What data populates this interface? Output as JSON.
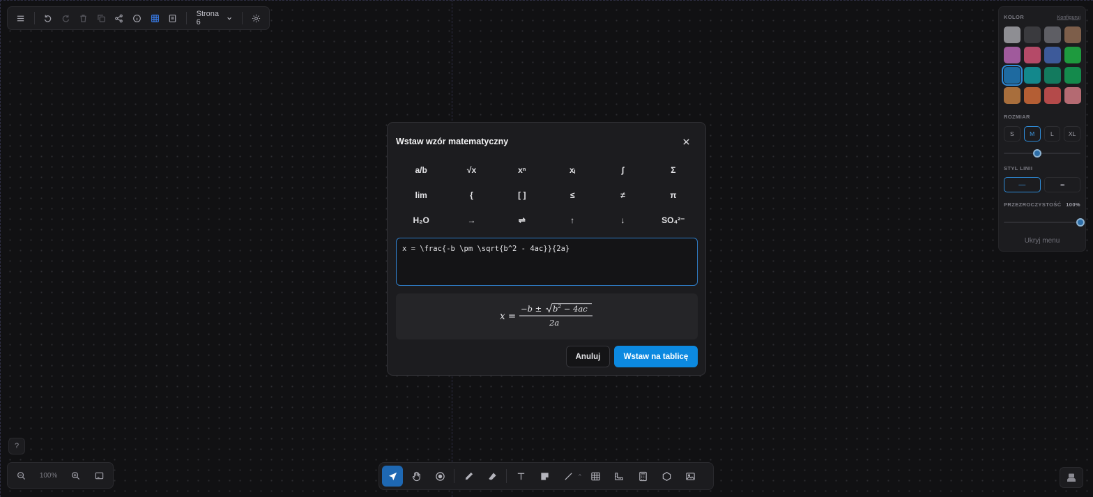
{
  "top_toolbar": {
    "page_label": "Strona 6"
  },
  "side_panel": {
    "color_label": "KOLOR",
    "configure_link": "Konfiguruj",
    "colors": [
      "#8e8e93",
      "#3a3a3e",
      "#5e5e64",
      "#7d5e4a",
      "#a05a9c",
      "#b54a68",
      "#3d5a9a",
      "#1e9a3e",
      "#1e6aa0",
      "#13888c",
      "#137a5e",
      "#148a4c",
      "#a86e3c",
      "#b45e34",
      "#b44a4a",
      "#b46a72"
    ],
    "selected_color_index": 8,
    "size_label": "ROZMIAR",
    "sizes": [
      "S",
      "M",
      "L",
      "XL"
    ],
    "selected_size": "M",
    "size_slider_fraction": 0.44,
    "line_style_label": "STYL LINII",
    "line_styles": [
      "—",
      "•••"
    ],
    "opacity_label": "PRZEZROCZYSTOŚĆ",
    "opacity_value": "100%",
    "opacity_fraction": 1.0,
    "hide_menu": "Ukryj menu"
  },
  "help": {
    "label": "?"
  },
  "zoom": {
    "value": "100%"
  },
  "modal": {
    "title": "Wstaw wzór matematyczny",
    "symbols": [
      [
        "a/b",
        "√x",
        "xⁿ",
        "xᵢ",
        "∫",
        "Σ"
      ],
      [
        "lim",
        "{",
        "[ ]",
        "≤",
        "≠",
        "π"
      ],
      [
        "H₂O",
        "→",
        "⇌",
        "↑",
        "↓",
        "SO₄²⁻"
      ]
    ],
    "latex_value": "x = \\frac{-b \\pm \\sqrt{b^2 - 4ac}}{2a}",
    "preview": {
      "lhs": "x =",
      "numerator_left": "−b ±",
      "radicand": "b",
      "radicand_exp": "2",
      "radicand_rest": " − 4ac",
      "denominator": "2a"
    },
    "cancel_label": "Anuluj",
    "insert_label": "Wstaw na tablicę"
  },
  "colors": {
    "accent": "#0c89e0",
    "selection": "#2e8bd8",
    "background": "#111113"
  }
}
